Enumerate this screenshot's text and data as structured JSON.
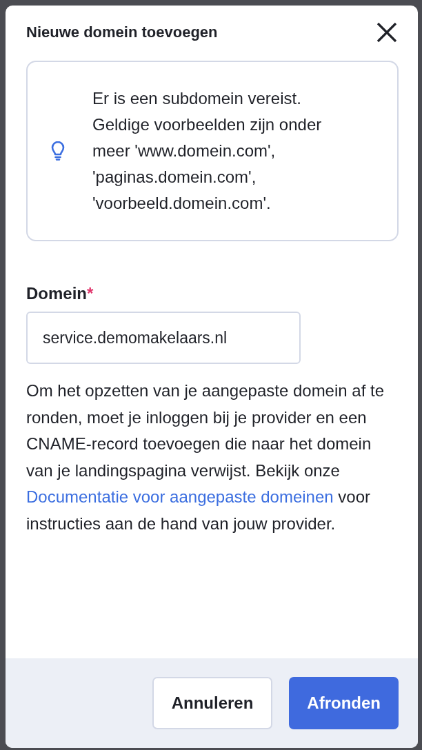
{
  "dialog": {
    "title": "Nieuwe domein toevoegen"
  },
  "tip": {
    "text": "Er is een subdomein vereist. Geldige voorbeelden zijn onder meer 'www.domein.com', 'paginas.domein.com', 'voorbeeld.domein.com'."
  },
  "field": {
    "label": "Domein",
    "required": true,
    "required_mark": "*",
    "value": "service.demomakelaars.nl"
  },
  "help": {
    "before": "Om het opzetten van je aangepaste domein af te ronden, moet je inloggen bij je provider en een CNAME-record toevoegen die naar het domein van je landingspagina verwijst. Bekijk onze",
    "link": "Documentatie voor aangepaste domeinen",
    "after": "voor instructies aan de hand van jouw provider."
  },
  "buttons": [
    {
      "label": "Annuleren",
      "kind": "secondary"
    },
    {
      "label": "Afronden",
      "kind": "primary"
    }
  ]
}
